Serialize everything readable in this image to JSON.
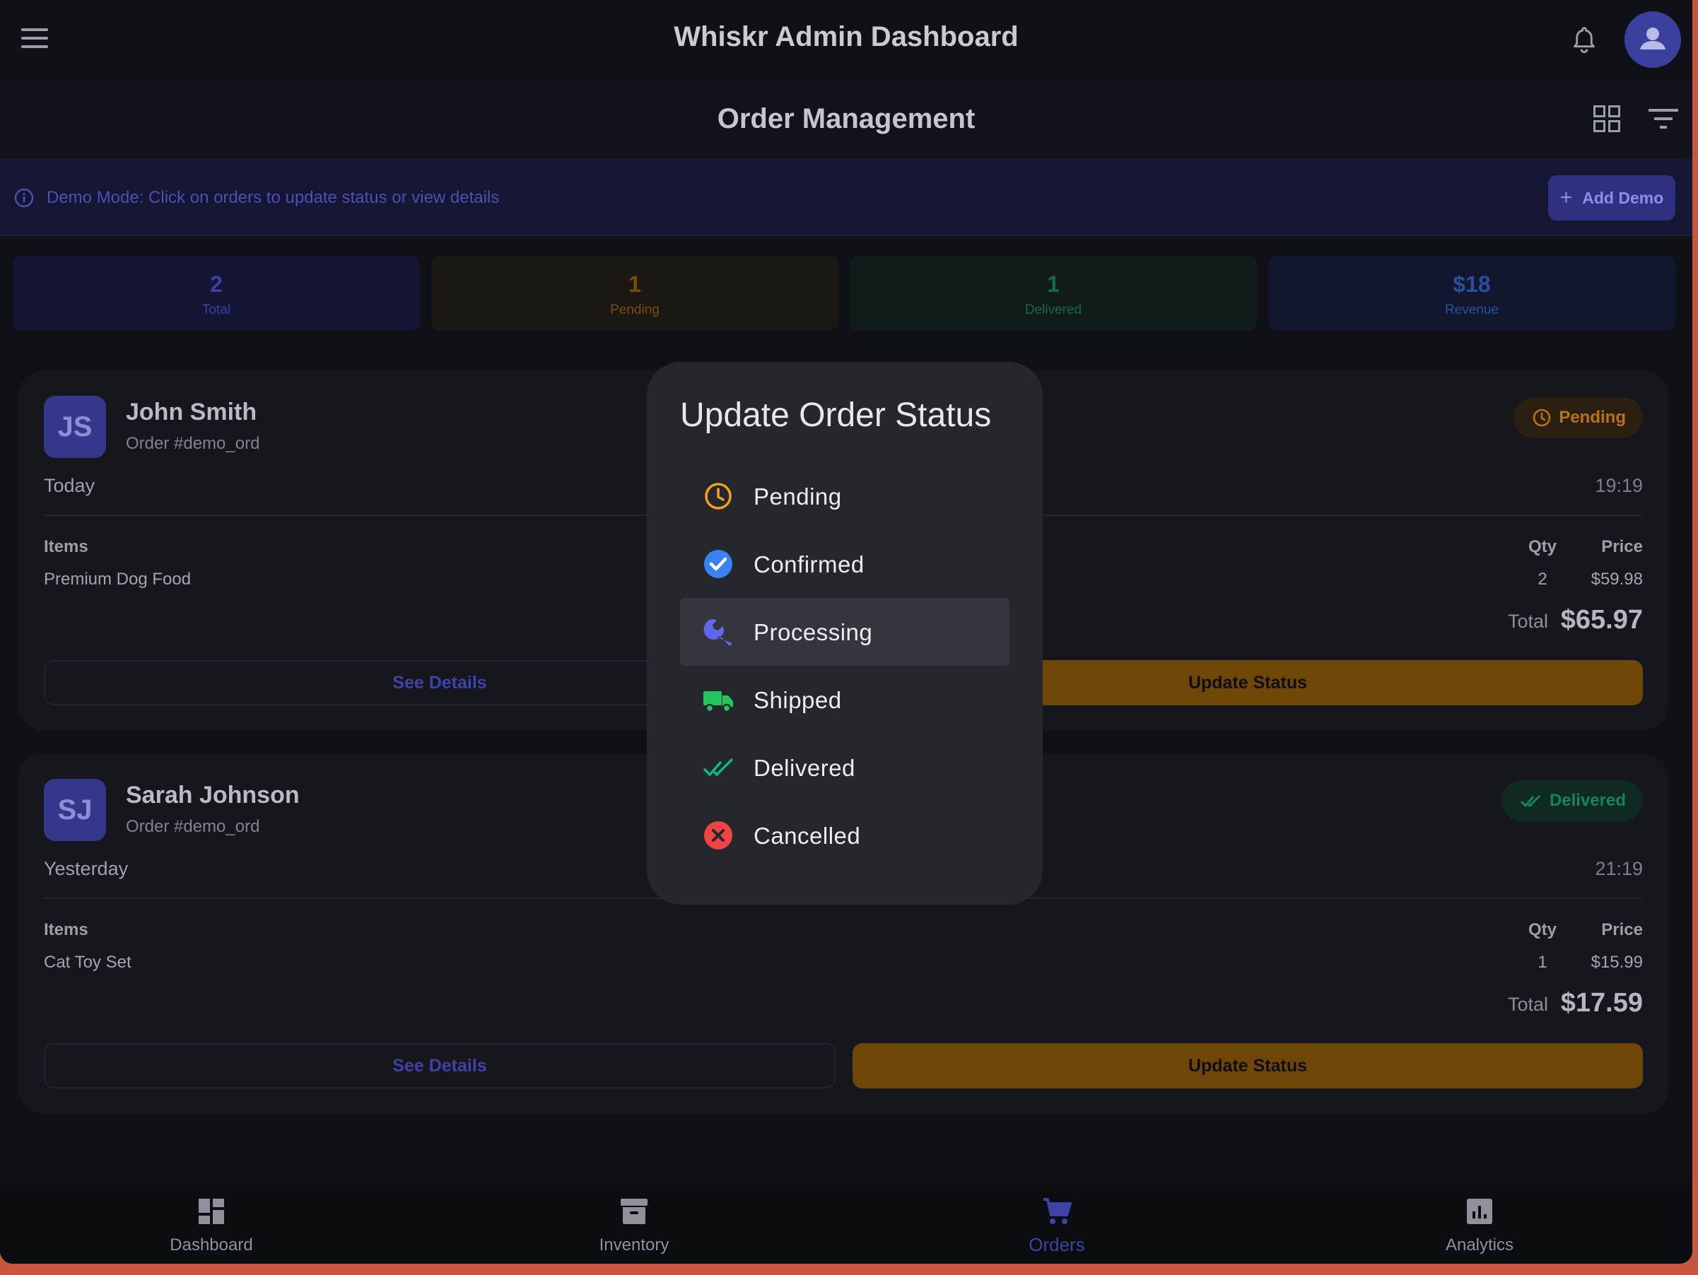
{
  "app": {
    "title": "Whiskr Admin Dashboard"
  },
  "page": {
    "title": "Order Management"
  },
  "banner": {
    "text": "Demo Mode: Click on orders to update status or view details",
    "button_label": "Add Demo"
  },
  "stats": [
    {
      "value": "2",
      "label": "Total",
      "color": "#3c3fa8",
      "bg": "#131533"
    },
    {
      "value": "1",
      "label": "Pending",
      "color": "#7a4c05",
      "bg": "#1b1712"
    },
    {
      "value": "1",
      "label": "Delivered",
      "color": "#17684a",
      "bg": "#0f1c19"
    },
    {
      "value": "$18",
      "label": "Revenue",
      "color": "#2b4f9a",
      "bg": "#121730"
    }
  ],
  "orders": [
    {
      "initials": "JS",
      "customer": "John Smith",
      "order_no": "Order #demo_ord",
      "status": "Pending",
      "day": "Today",
      "time": "19:19",
      "items_header": "Items",
      "qty_header": "Qty",
      "price_header": "Price",
      "items": [
        {
          "name": "Premium Dog Food",
          "qty": "2",
          "price": "$59.98"
        }
      ],
      "total_label": "Total",
      "total": "$65.97",
      "details_label": "See Details",
      "update_label": "Update Status"
    },
    {
      "initials": "SJ",
      "customer": "Sarah Johnson",
      "order_no": "Order #demo_ord",
      "status": "Delivered",
      "day": "Yesterday",
      "time": "21:19",
      "items_header": "Items",
      "qty_header": "Qty",
      "price_header": "Price",
      "items": [
        {
          "name": "Cat Toy Set",
          "qty": "1",
          "price": "$15.99"
        }
      ],
      "total_label": "Total",
      "total": "$17.59",
      "details_label": "See Details",
      "update_label": "Update Status"
    }
  ],
  "dialog": {
    "title": "Update Order Status",
    "options": [
      {
        "label": "Pending",
        "icon": "clock-icon",
        "color": "#f2a01d",
        "selected": false
      },
      {
        "label": "Confirmed",
        "icon": "check-circle-icon",
        "color": "#3b82f6",
        "selected": false
      },
      {
        "label": "Processing",
        "icon": "wrench-icon",
        "color": "#6366f1",
        "selected": true
      },
      {
        "label": "Shipped",
        "icon": "truck-icon",
        "color": "#22c55e",
        "selected": false
      },
      {
        "label": "Delivered",
        "icon": "double-check-icon",
        "color": "#10b981",
        "selected": false
      },
      {
        "label": "Cancelled",
        "icon": "cancel-circle-icon",
        "color": "#ef4444",
        "selected": false
      }
    ]
  },
  "bottom_nav": [
    {
      "label": "Dashboard",
      "icon": "dashboard-icon",
      "active": false
    },
    {
      "label": "Inventory",
      "icon": "archive-icon",
      "active": false
    },
    {
      "label": "Orders",
      "icon": "cart-icon",
      "active": true
    },
    {
      "label": "Analytics",
      "icon": "analytics-icon",
      "active": false
    }
  ],
  "colors": {
    "accent": "#3f42a6",
    "pending": "#b87412",
    "delivered": "#17845a",
    "update_button": "#6e4608"
  }
}
